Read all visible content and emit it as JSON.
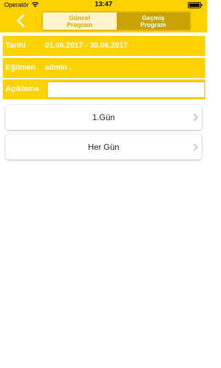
{
  "status_bar": {
    "carrier": "Operatör",
    "time": "13:47"
  },
  "header": {
    "segments": [
      {
        "label_line1": "Güncel",
        "label_line2": "Program",
        "selected": true
      },
      {
        "label_line1": "Geçmiş",
        "label_line2": "Program",
        "selected": false
      }
    ]
  },
  "info": {
    "date_label": "Tarihi",
    "date_value": "01.06.2017 - 30.06.2017",
    "trainer_label": "Eğitmen",
    "trainer_value": "admin .",
    "description_label": "Açıklama",
    "description_value": ""
  },
  "items": [
    {
      "label": "1.Gün"
    },
    {
      "label": "Her Gün"
    }
  ],
  "colors": {
    "accent": "#ffd200",
    "segment_inactive": "#c9a400",
    "segment_active_bg": "#fff5cc"
  },
  "icons": [
    "wifi-icon",
    "battery-icon",
    "back-chevron-icon",
    "chevron-right-icon"
  ]
}
